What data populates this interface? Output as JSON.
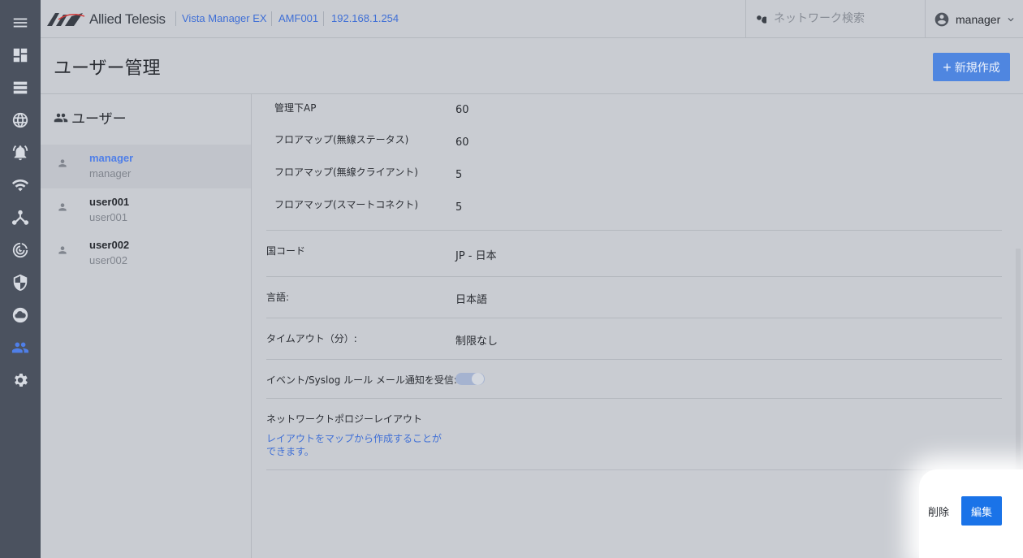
{
  "nav_rail": {
    "items": [
      {
        "icon": "menu-icon"
      },
      {
        "icon": "dashboard-icon"
      },
      {
        "icon": "list-icon"
      },
      {
        "icon": "globe-icon"
      },
      {
        "icon": "alarm-icon"
      },
      {
        "icon": "wifi-icon"
      },
      {
        "icon": "topology-icon"
      },
      {
        "icon": "radar-icon"
      },
      {
        "icon": "shield-icon"
      },
      {
        "icon": "cloud-icon"
      },
      {
        "icon": "users-icon",
        "active": true
      },
      {
        "icon": "gear-icon"
      }
    ],
    "active_color": "#4f7fe8"
  },
  "header": {
    "logo_text": "Allied Telesis",
    "product": "Vista Manager EX",
    "area": "AMF001",
    "address": "192.168.1.254",
    "search_placeholder": "ネットワーク検索",
    "user": "manager"
  },
  "page": {
    "title": "ユーザー管理",
    "new_button": "新規作成"
  },
  "user_panel": {
    "heading": "ユーザー",
    "users": [
      {
        "name": "manager",
        "sub": "manager",
        "selected": true
      },
      {
        "name": "user001",
        "sub": "user001",
        "selected": false
      },
      {
        "name": "user002",
        "sub": "user002",
        "selected": false
      }
    ]
  },
  "detail": {
    "ap_rows": [
      {
        "label": "管理下AP",
        "value": "60"
      },
      {
        "label": "フロアマップ(無線ステータス)",
        "value": "60"
      },
      {
        "label": "フロアマップ(無線クライアント)",
        "value": "5"
      },
      {
        "label": "フロアマップ(スマートコネクト)",
        "value": "5"
      }
    ],
    "country_label": "国コード",
    "country_value": "JP - 日本",
    "language_label": "言語:",
    "language_value": "日本語",
    "timeout_label": "タイムアウト（分）:",
    "timeout_value": "制限なし",
    "notify_label": "イベント/Syslog ルール メール通知を受信:",
    "notify_on": true,
    "topology_label": "ネットワークトポロジーレイアウト",
    "topology_link": "レイアウトをマップから作成することができます。"
  },
  "actions": {
    "delete": "削除",
    "edit": "編集"
  },
  "colors": {
    "primary": "#1a73e8",
    "accent_blue": "#4f86e0",
    "rail_bg": "#4b525f"
  }
}
